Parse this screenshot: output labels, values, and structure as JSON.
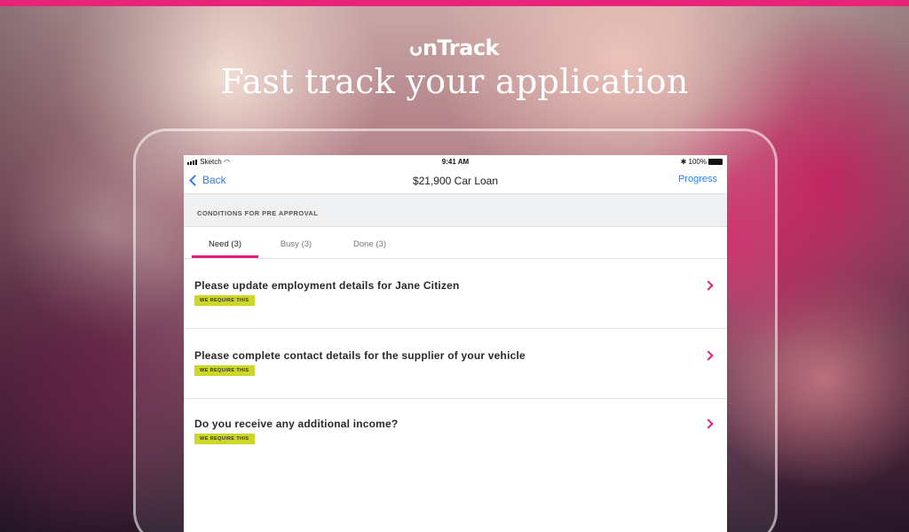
{
  "brand": {
    "logo_text": "nTrack",
    "accent": "#e8247a"
  },
  "hero": {
    "headline": "Fast track your application"
  },
  "status_bar": {
    "carrier": "Sketch",
    "time": "9:41 AM",
    "battery": "100%"
  },
  "nav": {
    "back_label": "Back",
    "title": "$21,900 Car Loan",
    "progress_label": "Progress"
  },
  "section": {
    "header": "CONDITIONS FOR PRE APPROVAL"
  },
  "tabs": [
    {
      "label": "Need (3)",
      "active": true
    },
    {
      "label": "Busy (3)",
      "active": false
    },
    {
      "label": "Done (3)",
      "active": false
    }
  ],
  "items": [
    {
      "title": "Please update employment details for Jane Citizen",
      "badge": "WE REQUIRE THIS"
    },
    {
      "title": "Please complete contact details for the supplier of your vehicle",
      "badge": "WE REQUIRE THIS"
    },
    {
      "title": "Do you receive any additional income?",
      "badge": "WE REQUIRE THIS"
    }
  ],
  "colors": {
    "link_blue": "#2a7ef0",
    "badge_yellow": "#cdd72a",
    "tab_pink": "#e0207a"
  }
}
